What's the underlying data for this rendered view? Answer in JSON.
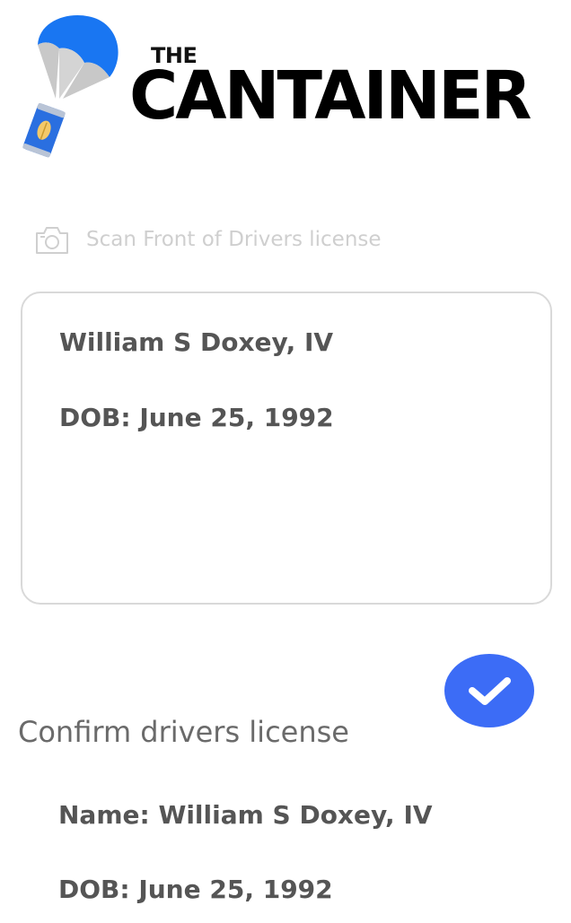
{
  "brand": {
    "top_word": "THE",
    "name": "CANTAINER",
    "logo_icon": "parachute-can-icon",
    "colors": {
      "parachute": "#1976f2",
      "can": "#2a6fe0",
      "text": "#000000"
    }
  },
  "scan": {
    "icon": "camera-icon",
    "label": "Scan Front of Drivers license"
  },
  "scan_result": {
    "name": "William S Doxey, IV",
    "dob": "DOB: June 25, 1992"
  },
  "confirm": {
    "heading": "Confirm drivers license",
    "button_icon": "checkmark-icon",
    "button_color": "#3c6cf6",
    "name": "Name: William S Doxey, IV",
    "dob": "DOB: June 25, 1992"
  }
}
